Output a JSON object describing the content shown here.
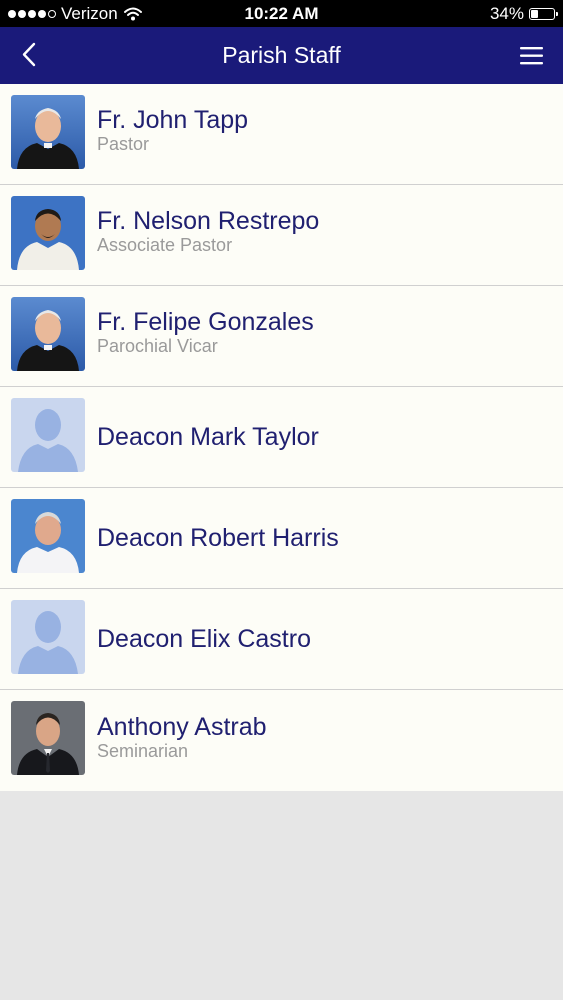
{
  "status_bar": {
    "carrier": "Verizon",
    "time": "10:22 AM",
    "battery_percent": "34%",
    "battery_level": 0.34,
    "signal_bars": 4,
    "signal_total": 5
  },
  "nav": {
    "title": "Parish Staff",
    "back_icon": "chevron-left-icon",
    "menu_icon": "hamburger-menu-icon",
    "bar_color": "#1a1a7a"
  },
  "staff": [
    {
      "name": "Fr. John Tapp",
      "role": "Pastor",
      "photo": "clergy-photo"
    },
    {
      "name": "Fr. Nelson Restrepo",
      "role": "Associate Pastor",
      "photo": "alb-photo"
    },
    {
      "name": "Fr. Felipe Gonzales",
      "role": "Parochial Vicar",
      "photo": "clergy-photo"
    },
    {
      "name": "Deacon Mark Taylor",
      "role": "",
      "photo": "placeholder-avatar"
    },
    {
      "name": "Deacon Robert Harris",
      "role": "",
      "photo": "casual-photo"
    },
    {
      "name": "Deacon Elix Castro",
      "role": "",
      "photo": "placeholder-avatar"
    },
    {
      "name": "Anthony Astrab",
      "role": "Seminarian",
      "photo": "suit-photo"
    }
  ],
  "colors": {
    "name_text": "#202070",
    "role_text": "#9a9a9a",
    "list_background": "#fdfdf7",
    "page_background": "#e6e6e6"
  }
}
